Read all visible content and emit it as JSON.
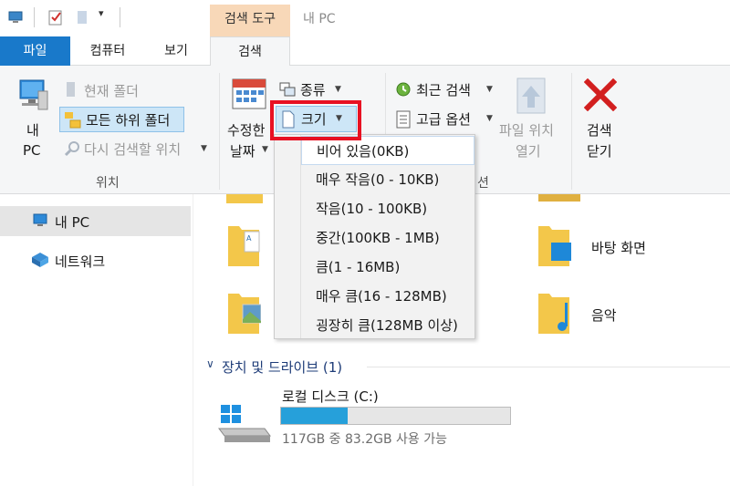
{
  "window": {
    "title": "내 PC",
    "context_tab_group": "검색 도구"
  },
  "ribbon_tabs": {
    "file": "파일",
    "computer": "컴퓨터",
    "view": "보기",
    "search": "검색"
  },
  "ribbon": {
    "location": {
      "this_pc_line1": "내",
      "this_pc_line2": "PC",
      "current_folder": "현재 폴더",
      "all_subfolders": "모든 하위 폴더",
      "search_again": "다시 검색할 위치",
      "group_label": "위치"
    },
    "refine": {
      "date_modified_line1": "수정한",
      "date_modified_line2": "날짜",
      "kind": "종류",
      "size": "크기",
      "group_label_tail": "션"
    },
    "options": {
      "recent_searches": "최근 검색",
      "advanced_options": "고급 옵션",
      "open_location_line1": "파일 위치",
      "open_location_line2": "열기"
    },
    "close": {
      "line1": "검색",
      "line2": "닫기"
    }
  },
  "size_menu": {
    "items": [
      "비어 있음(0KB)",
      "매우 작음(0 - 10KB)",
      "작음(10 - 100KB)",
      "중간(100KB - 1MB)",
      "큼(1 - 16MB)",
      "매우 큼(16 - 128MB)",
      "굉장히 큼(128MB 이상)"
    ],
    "highlighted_index": 0
  },
  "nav_pane": {
    "this_pc": "내 PC",
    "network": "네트워크"
  },
  "content": {
    "folders_right": [
      "바탕 화면",
      "음악"
    ],
    "devices_header": "장치 및 드라이브 (1)",
    "drive": {
      "name": "로컬 디스크 (C:)",
      "free_text": "117GB 중 83.2GB 사용 가능",
      "used_fraction": 0.29
    }
  },
  "colors": {
    "file_tab": "#1979ca",
    "context_tab": "#f8d8b8",
    "drive_fill": "#26a0da",
    "highlight_box": "#e81123"
  }
}
